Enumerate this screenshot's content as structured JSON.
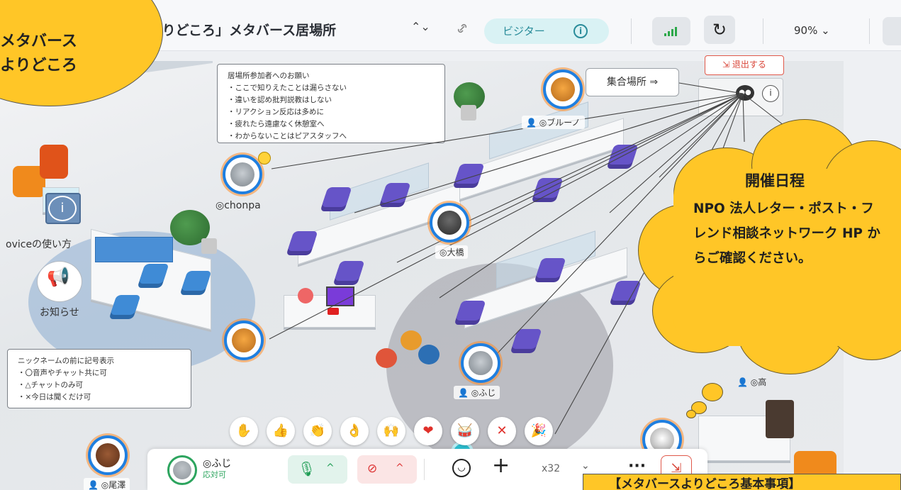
{
  "header": {
    "room_title": "よりどころ」メタバース居場所",
    "visitor_label": "ビジター",
    "zoom_level": "90% ⌄"
  },
  "callouts": {
    "top_left_text": "メタバース\nよりどころ",
    "cloud_title": "開催日程",
    "cloud_body": "NPO 法人レター・ポスト・フレンド相談ネットワーク HP からご確認ください。",
    "bottom_banner": "【メタバースよりどころ基本事項】"
  },
  "map": {
    "rules_note": [
      "居場所参加者へのお願い",
      "・ここで知りえたことは漏らさない",
      "・違いを認め批判説教はしない",
      "・リアクション反応は多めに",
      "・疲れたら遠慮なく休憩室へ",
      "・わからないことはピアスタッフへ"
    ],
    "nickname_note": [
      "ニックネームの前に記号表示",
      "・〇音声やチャット共に可",
      "・△チャットのみ可",
      "・×今日は聞くだけ可"
    ],
    "meeting_point": "集合場所 ⇒",
    "exit_button": "退出する",
    "ovice_guide": "oviceの使い方",
    "announcement": "お知らせ",
    "avatars": [
      {
        "name": "◎ブルーノ"
      },
      {
        "name": "◎chonpa"
      },
      {
        "name": "◎大橋"
      },
      {
        "name": "◎ふじ"
      },
      {
        "name": "◎尾澤"
      },
      {
        "name": "◎高"
      }
    ]
  },
  "reactions": [
    "✋",
    "👍",
    "👏",
    "👌",
    "🙌",
    "❤",
    "🥁",
    "✕",
    "🎉"
  ],
  "toolbar": {
    "user_name": "◎ふじ",
    "user_status": "応対可",
    "mic_caret": "^",
    "cam_caret": "^",
    "plus": "+",
    "speaker_count": "x32",
    "more": "···"
  },
  "colors": {
    "accent_yellow": "#ffc627",
    "avatar_ring": "#1f7fe0",
    "exit_red": "#d9473a",
    "mic_green": "#1f9d55",
    "visitor_teal": "#2a8c9a"
  }
}
